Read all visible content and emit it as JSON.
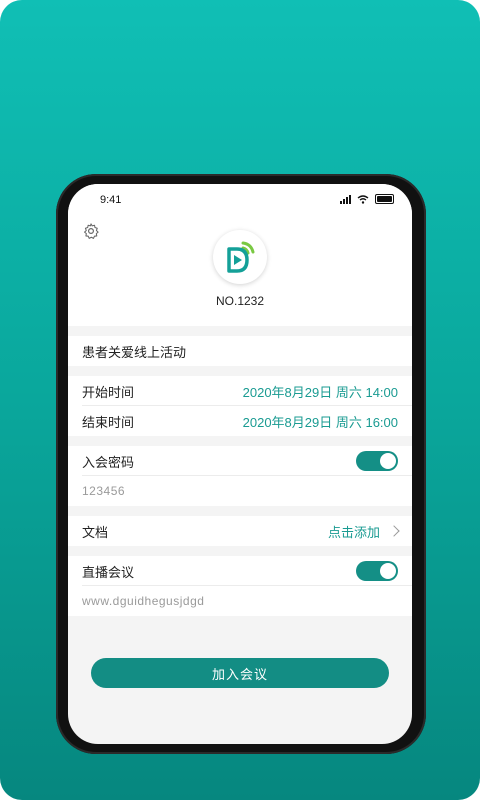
{
  "status_bar": {
    "time": "9:41"
  },
  "meeting": {
    "number": "NO.1232",
    "title": "患者关爱线上活动"
  },
  "schedule": [
    {
      "label": "开始时间",
      "value": "2020年8月29日  周六 14:00"
    },
    {
      "label": "结束时间",
      "value": "2020年8月29日  周六 16:00"
    }
  ],
  "password": {
    "label": "入会密码",
    "value": "123456",
    "enabled": true
  },
  "documents": {
    "label": "文档",
    "action": "点击添加"
  },
  "live": {
    "label": "直播会议",
    "url": "www.dguidhegusjdgd",
    "enabled": true
  },
  "join_button": {
    "label": "加入会议"
  },
  "colors": {
    "accent": "#138d84",
    "background_top": "#10bfb5",
    "background_bottom": "#06877f"
  },
  "icons": [
    "settings-icon",
    "app-logo-icon",
    "signal-icon",
    "wifi-icon",
    "battery-icon",
    "chevron-right-icon"
  ]
}
